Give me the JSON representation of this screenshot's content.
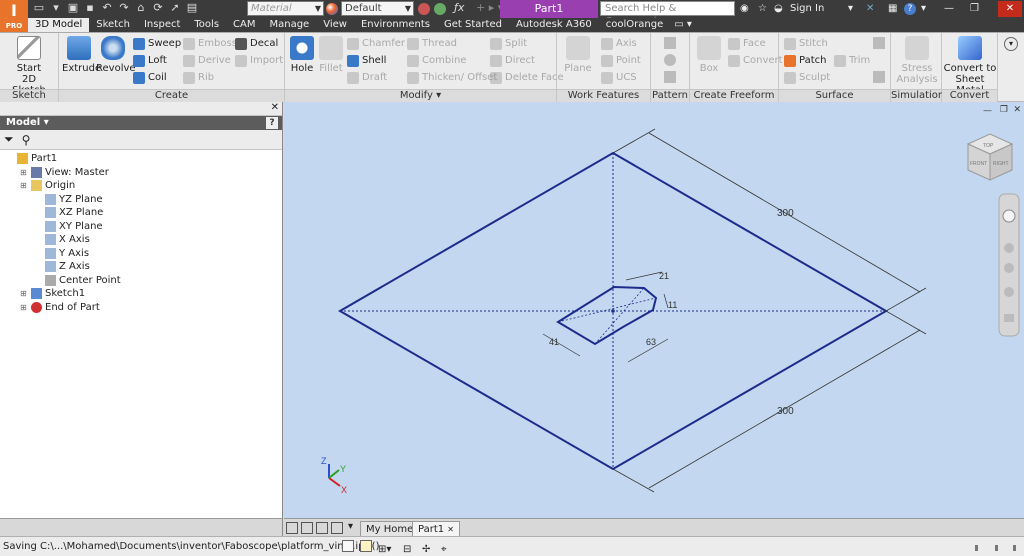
{
  "app": {
    "logo": "I",
    "logo_sub": "PRO"
  },
  "titlebar": {
    "material_placeholder": "Material",
    "appearance_value": "Default",
    "document_title": "Part1",
    "search_placeholder": "Search Help & Commands...",
    "sign_in": "Sign In"
  },
  "tabs": [
    "3D Model",
    "Sketch",
    "Inspect",
    "Tools",
    "CAM",
    "Manage",
    "View",
    "Environments",
    "Get Started",
    "Autodesk A360",
    "coolOrange"
  ],
  "ribbon": {
    "sketch": {
      "title": "Sketch",
      "start_sketch": [
        "Start",
        "2D Sketch"
      ]
    },
    "create": {
      "title": "Create",
      "extrude": "Extrude",
      "revolve": "Revolve",
      "sweep": "Sweep",
      "loft": "Loft",
      "coil": "Coil",
      "emboss": "Emboss",
      "derive": "Derive",
      "rib": "Rib",
      "decal": "Decal",
      "import": "Import"
    },
    "modify": {
      "title": "Modify",
      "hole": "Hole",
      "fillet": "Fillet",
      "chamfer": "Chamfer",
      "shell": "Shell",
      "draft": "Draft",
      "thread": "Thread",
      "combine": "Combine",
      "thicken": "Thicken/ Offset",
      "split": "Split",
      "direct": "Direct",
      "delete_face": "Delete Face"
    },
    "work_features": {
      "title": "Work Features",
      "plane": "Plane",
      "axis": "Axis",
      "point": "Point",
      "ucs": "UCS"
    },
    "pattern": {
      "title": "Pattern"
    },
    "freeform": {
      "title": "Create Freeform",
      "box": "Box",
      "face": "Face",
      "convert": "Convert"
    },
    "surface": {
      "title": "Surface",
      "stitch": "Stitch",
      "patch": "Patch",
      "sculpt": "Sculpt",
      "trim": "Trim"
    },
    "simulation": {
      "title": "Simulation",
      "stress": [
        "Stress",
        "Analysis"
      ]
    },
    "convert": {
      "title": "Convert",
      "sheet_metal": [
        "Convert to",
        "Sheet Metal"
      ]
    }
  },
  "browser": {
    "header": "Model",
    "tree": [
      {
        "label": "Part1",
        "indent": 0,
        "icon": "part-icon"
      },
      {
        "label": "View: Master",
        "indent": 1,
        "icon": "view-icon"
      },
      {
        "label": "Origin",
        "indent": 1,
        "icon": "folder-icon"
      },
      {
        "label": "YZ Plane",
        "indent": 2,
        "icon": "plane-icon"
      },
      {
        "label": "XZ Plane",
        "indent": 2,
        "icon": "plane-icon"
      },
      {
        "label": "XY Plane",
        "indent": 2,
        "icon": "plane-icon"
      },
      {
        "label": "X Axis",
        "indent": 2,
        "icon": "axis-icon"
      },
      {
        "label": "Y Axis",
        "indent": 2,
        "icon": "axis-icon"
      },
      {
        "label": "Z Axis",
        "indent": 2,
        "icon": "axis-icon"
      },
      {
        "label": "Center Point",
        "indent": 2,
        "icon": "point-icon"
      },
      {
        "label": "Sketch1",
        "indent": 1,
        "icon": "sketch-icon"
      },
      {
        "label": "End of Part",
        "indent": 1,
        "icon": "end-of-part-icon"
      }
    ]
  },
  "viewport": {
    "dimensions": {
      "top_right": "300",
      "bottom_right": "300",
      "small_top": "21",
      "small_right": "11",
      "small_left": "41",
      "small_bottom": "63"
    },
    "viewcube": {
      "front": "FRONT",
      "right": "RIGHT",
      "top": "TOP"
    },
    "triad": {
      "x": "X",
      "y": "Y",
      "z": "Z"
    }
  },
  "doctabs": {
    "home": "My Home",
    "part": "Part1"
  },
  "statusbar": {
    "text": "Saving C:\\...\\Mohamed\\Documents\\inventor\\Faboscope\\platform_vinyl.ipt ()"
  },
  "colors": {
    "viewport_bg": "#c3d8f0",
    "sketch_line": "#1c2b8c",
    "title_doc_bg": "#9a3fb0",
    "app_orange": "#e8742c"
  }
}
